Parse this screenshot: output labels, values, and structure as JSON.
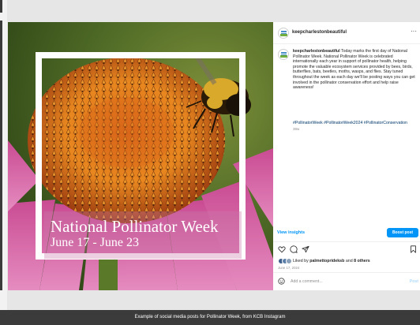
{
  "post": {
    "headline": "National Pollinator Week",
    "dates": "June 17 - June 23"
  },
  "panel": {
    "username": "keepcharlestonbeautiful",
    "more_glyph": "···",
    "caption_text": " Today marks the first day of National Pollinator Week. National Pollinator Week is celebrated internationally each year in support of pollinator health, helping promote the valuable ecosystem services provided by bees, birds, butterflies, bats, beetles, moths, wasps, and flies. Stay tuned throughout the week as each day we'll be posting ways you can get involved in the pollinator conservation effort and help raise awareness!",
    "hashtags": "#PollinatorWeek #PollinatorWeek2024 #PollinatorConservation",
    "age": "38w",
    "view_insights": "View insights",
    "boost_post": "Boost post",
    "liked_prefix": "Liked by ",
    "liked_user": "palmettoprideksb",
    "liked_mid": " and ",
    "liked_others": "8 others",
    "post_date": "June 17, 2024",
    "add_comment_placeholder": "Add a comment...",
    "post_label": "Post"
  },
  "footer": {
    "caption": "Example of social media posts for Pollinator Week, from KCB Instagram"
  },
  "colors": {
    "accent": "#0095f6",
    "petal": "#d14d9a",
    "cone": "#e8761c",
    "frame": "#ffffff",
    "footer_bg": "#3b3b3b"
  }
}
